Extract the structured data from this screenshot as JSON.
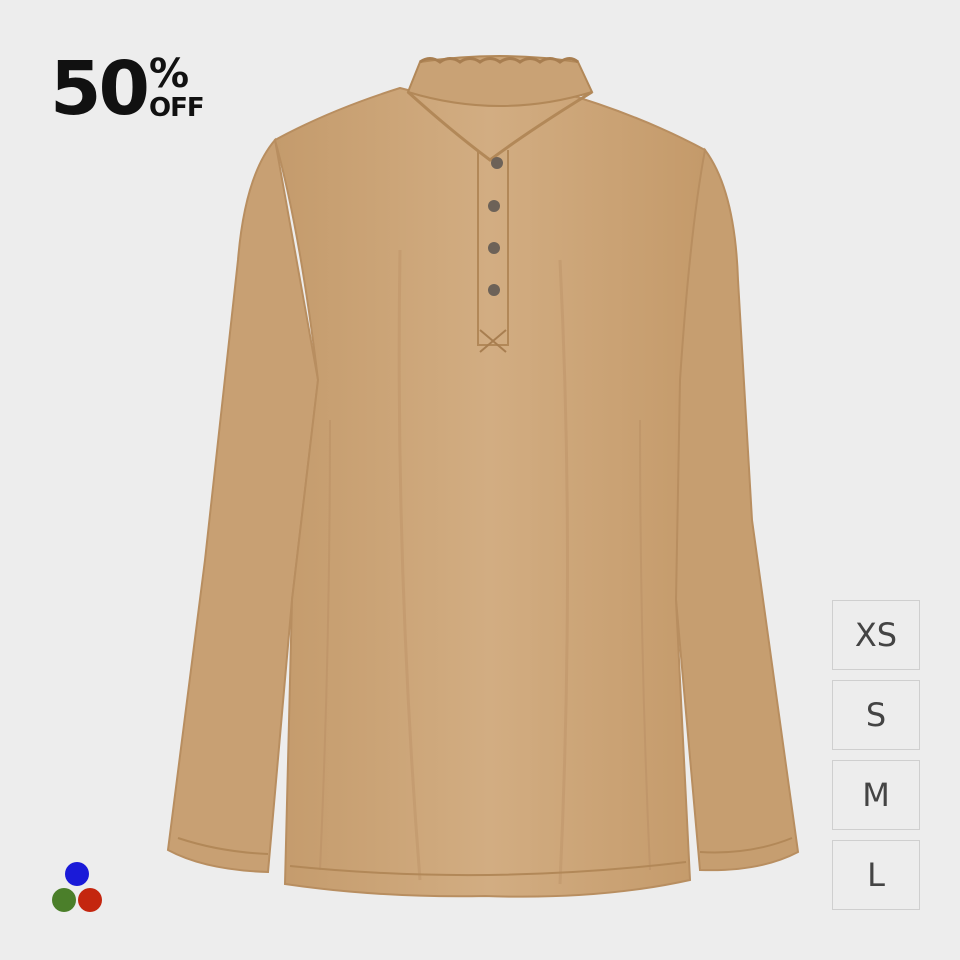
{
  "discount": {
    "number": "50",
    "percent": "%",
    "off": "OFF"
  },
  "product": {
    "color": "#cda77a"
  },
  "sizes": [
    {
      "label": "XS"
    },
    {
      "label": "S"
    },
    {
      "label": "M"
    },
    {
      "label": "L"
    }
  ],
  "swatches": [
    {
      "name": "blue",
      "color": "#1a1ad8"
    },
    {
      "name": "green",
      "color": "#4b7f2a"
    },
    {
      "name": "red",
      "color": "#c4260f"
    }
  ]
}
